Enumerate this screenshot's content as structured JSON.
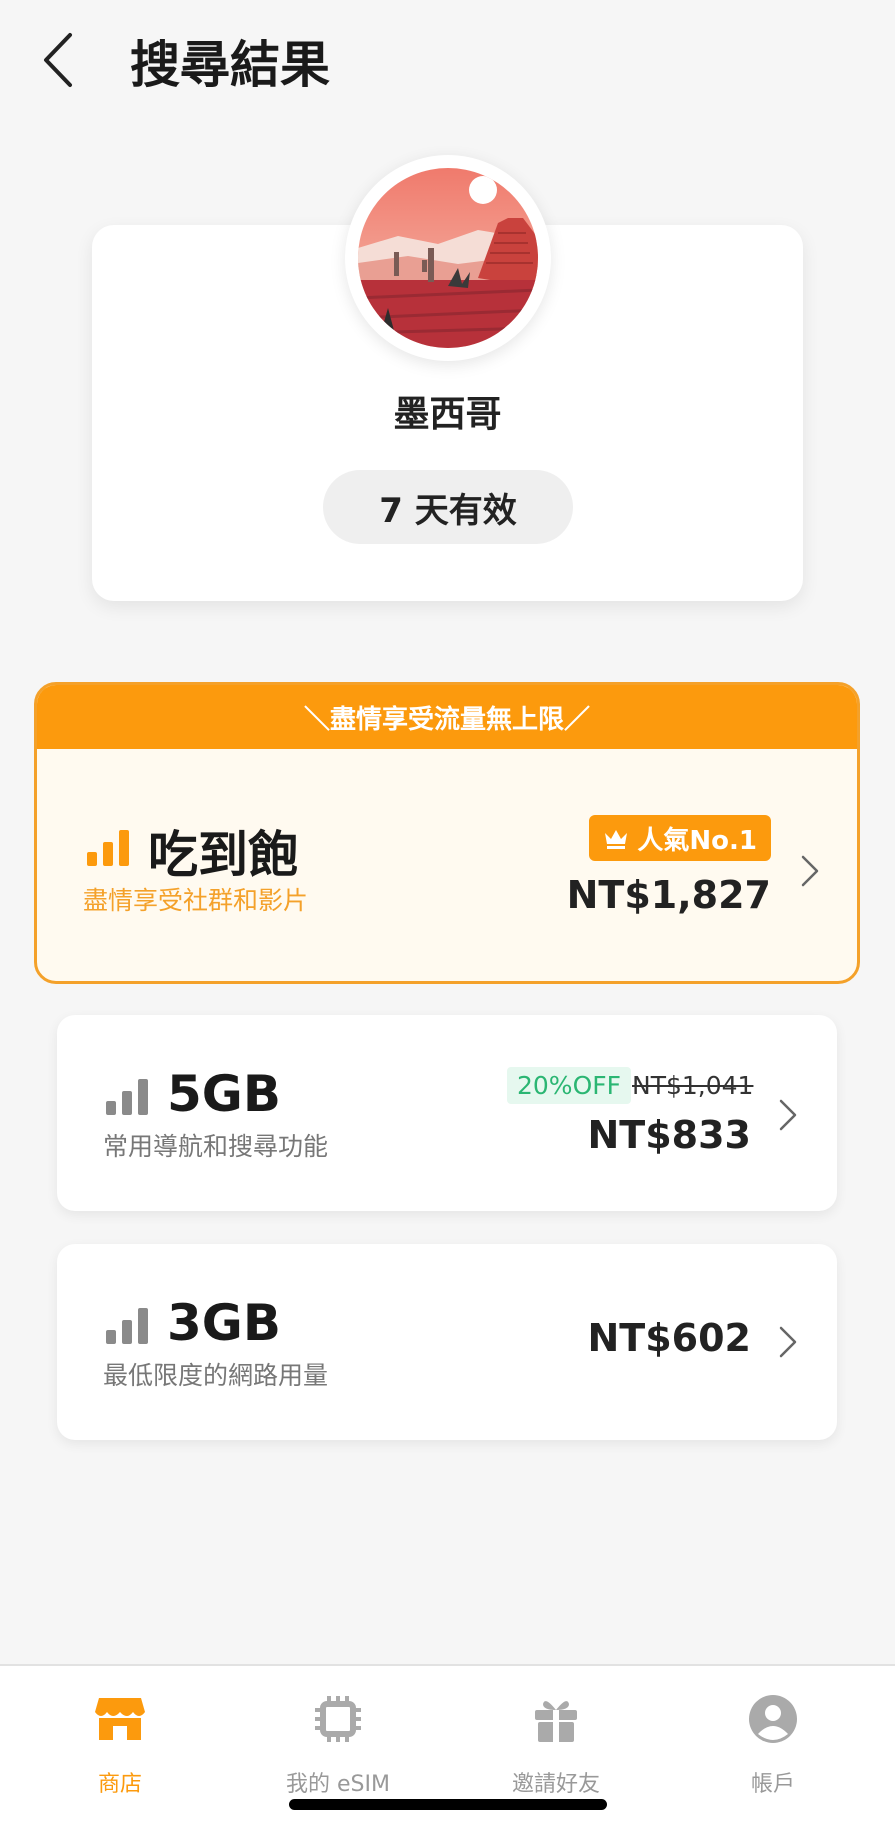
{
  "header": {
    "title": "搜尋結果"
  },
  "country": {
    "name": "墨西哥",
    "validity": "7 天有效"
  },
  "featured_plan": {
    "banner": "＼盡情享受流量無上限／",
    "name": "吃到飽",
    "description": "盡情享受社群和影片",
    "badge": "人氣No.1",
    "price": "NT$1,827"
  },
  "plans": [
    {
      "name": "5GB",
      "description": "常用導航和搜尋功能",
      "discount": "20%OFF",
      "original_price": "NT$1,041",
      "price": "NT$833"
    },
    {
      "name": "3GB",
      "description": "最低限度的網路用量",
      "price": "NT$602"
    }
  ],
  "nav": {
    "items": [
      {
        "label": "商店",
        "icon": "store-icon",
        "active": true
      },
      {
        "label": "我的 eSIM",
        "icon": "chip-icon",
        "active": false
      },
      {
        "label": "邀請好友",
        "icon": "gift-icon",
        "active": false
      },
      {
        "label": "帳戶",
        "icon": "account-icon",
        "active": false
      }
    ]
  },
  "colors": {
    "accent": "#fc9a0d",
    "discount_green": "#2bb673"
  }
}
